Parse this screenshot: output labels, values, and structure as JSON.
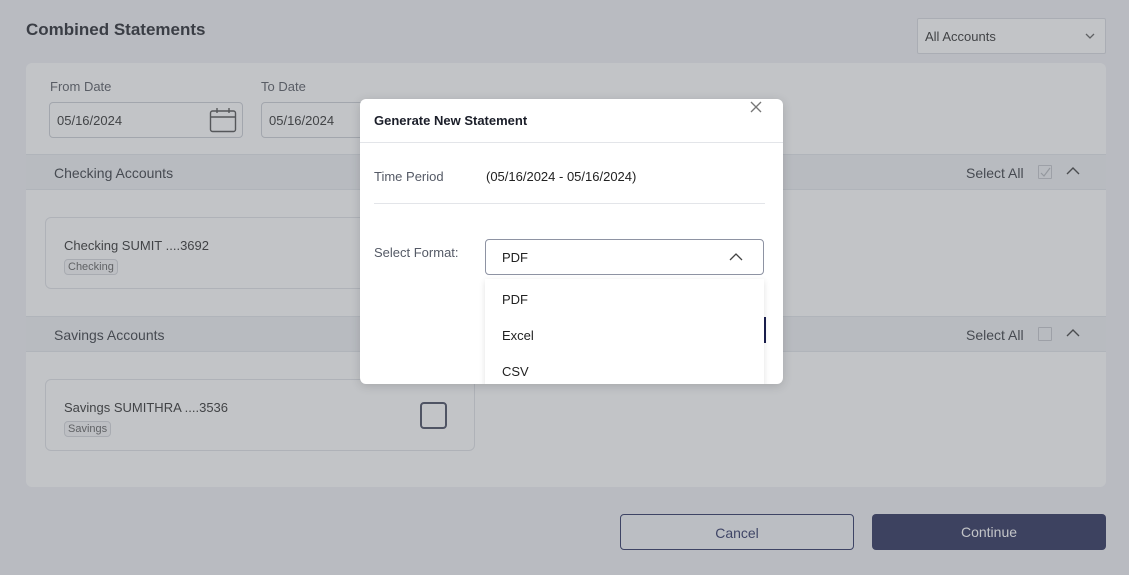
{
  "page": {
    "title": "Combined Statements",
    "account_filter": "All Accounts",
    "from_date": {
      "label": "From Date",
      "value": "05/16/2024"
    },
    "to_date": {
      "label": "To Date",
      "value": "05/16/2024"
    },
    "sections": [
      {
        "title": "Checking Accounts",
        "select_all": "Select All",
        "accounts": [
          {
            "name": "Checking SUMIT ....3692",
            "tag": "Checking"
          }
        ]
      },
      {
        "title": "Savings Accounts",
        "select_all": "Select All",
        "accounts": [
          {
            "name": "Savings SUMITHRA ....3536",
            "tag": "Savings"
          }
        ]
      }
    ],
    "buttons": {
      "cancel": "Cancel",
      "continue": "Continue"
    }
  },
  "modal": {
    "title": "Generate New Statement",
    "time_period_label": "Time Period",
    "time_period_value": "(05/16/2024 - 05/16/2024)",
    "format_label": "Select Format:",
    "format_selected": "PDF",
    "format_options": [
      "PDF",
      "Excel",
      "CSV"
    ]
  },
  "colors": {
    "primary": "#1b1f4f",
    "overlay": "#6e727a"
  }
}
